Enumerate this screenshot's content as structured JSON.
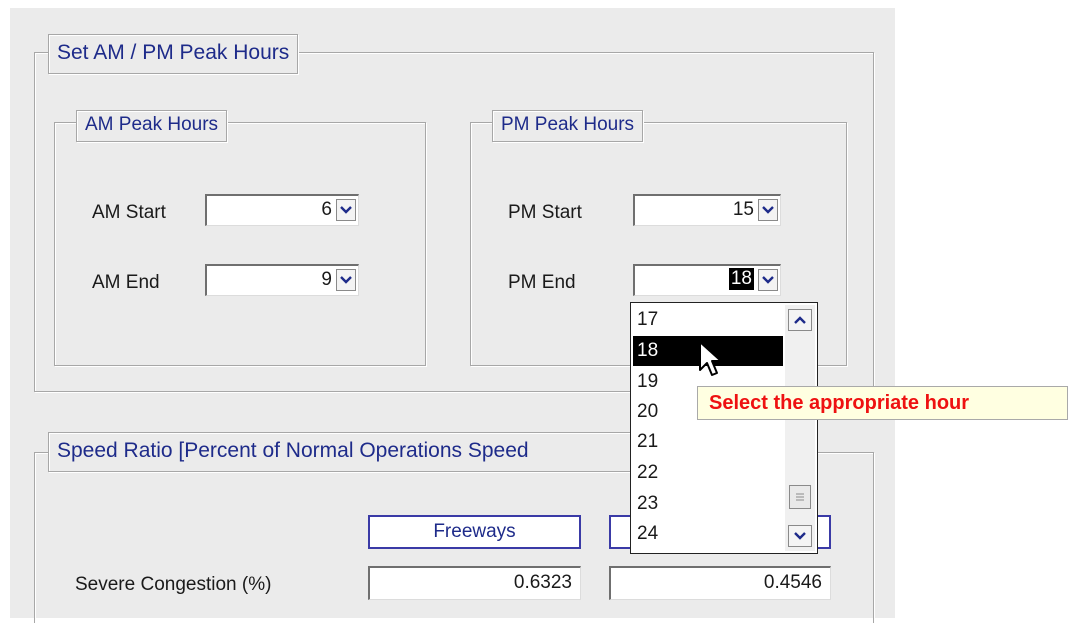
{
  "peak_hours": {
    "title": "Set AM / PM Peak Hours",
    "am": {
      "title": "AM Peak Hours",
      "start_label": "AM Start",
      "start_value": "6",
      "end_label": "AM End",
      "end_value": "9"
    },
    "pm": {
      "title": "PM Peak Hours",
      "start_label": "PM Start",
      "start_value": "15",
      "end_label": "PM End",
      "end_value": "18"
    }
  },
  "hour_dropdown": {
    "options": [
      "17",
      "18",
      "19",
      "20",
      "21",
      "22",
      "23",
      "24"
    ],
    "highlighted": "18"
  },
  "tooltip": {
    "text": "Select the appropriate hour",
    "color": "#ee1111"
  },
  "speed_ratio": {
    "title": "Speed Ratio [Percent of Normal Operations Speed",
    "columns": [
      "Freeways",
      ""
    ],
    "rows": [
      {
        "label": "Severe Congestion (%)",
        "values": [
          "0.6323",
          "0.4546"
        ]
      }
    ]
  },
  "icons": {
    "combo_arrow": "chevron-down-icon",
    "scroll_up": "chevron-up-icon",
    "scroll_down": "chevron-down-icon",
    "thumb": "grip-icon",
    "pointer": "mouse-pointer-icon"
  },
  "colors": {
    "panel_bg": "#ebebeb",
    "group_title": "#1e2b8a",
    "tooltip_bg": "#ffffe1",
    "highlight": "#000000"
  }
}
